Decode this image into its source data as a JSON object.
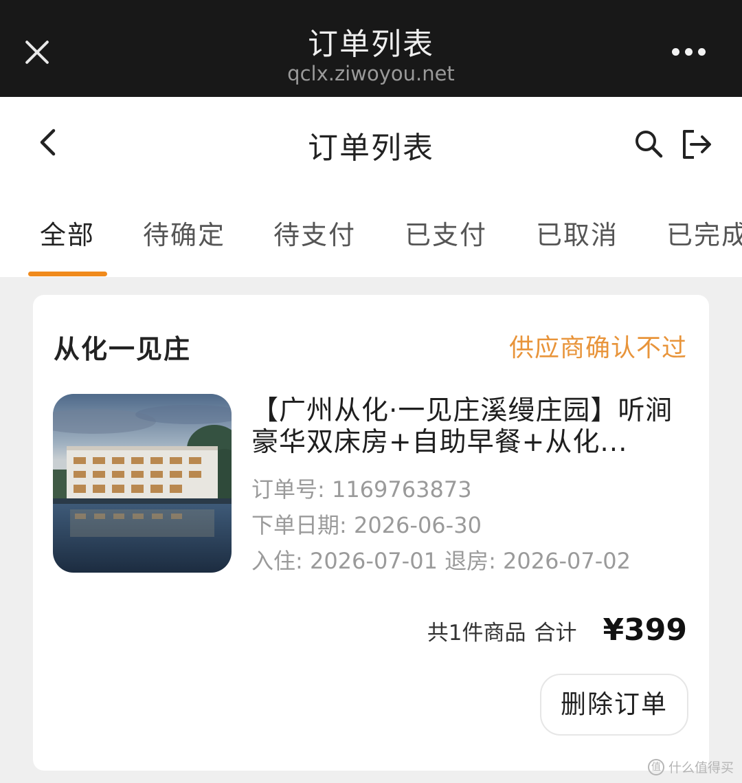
{
  "browser": {
    "title": "订单列表",
    "url": "qclx.ziwoyou.net"
  },
  "header": {
    "title": "订单列表"
  },
  "tabs": [
    {
      "label": "全部",
      "active": true
    },
    {
      "label": "待确定",
      "active": false
    },
    {
      "label": "待支付",
      "active": false
    },
    {
      "label": "已支付",
      "active": false
    },
    {
      "label": "已取消",
      "active": false
    },
    {
      "label": "已完成",
      "active": false
    }
  ],
  "order": {
    "shop_name": "从化一见庄",
    "status": "供应商确认不过",
    "product_title": "【广州从化·一见庄溪缦庄园】听涧豪华双床房+自助早餐+从化...",
    "order_no": "订单号: 1169763873",
    "order_date": "下单日期: 2026-06-30",
    "stay": "入住: 2026-07-01 退房: 2026-07-02",
    "item_count": "共1件商品",
    "total_label": "合计",
    "total_price": "¥399",
    "delete_label": "删除订单"
  },
  "watermark": {
    "badge": "值",
    "text": "什么值得买"
  },
  "colors": {
    "accent": "#f08a1c",
    "status": "#e8943a",
    "browser_bar": "#181818"
  }
}
